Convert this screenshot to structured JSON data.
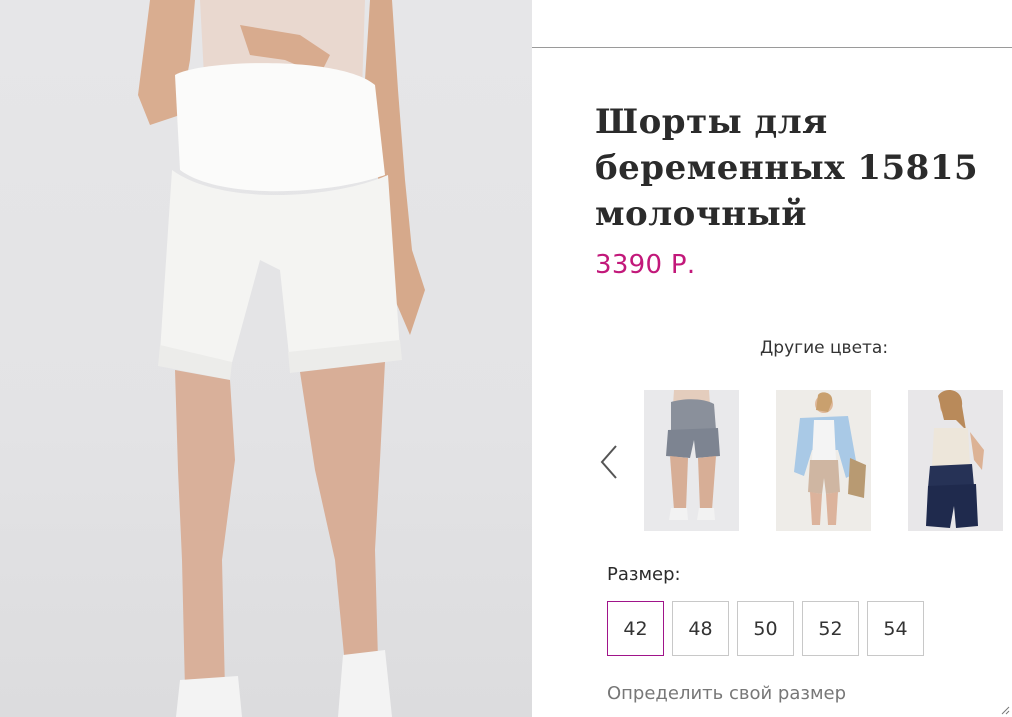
{
  "product": {
    "title": "Шорты для беременных 15815 молочный",
    "price": "3390 Р."
  },
  "colors": {
    "label": "Другие цвета:",
    "swatches": [
      {
        "name": "grey-shorts-swatch",
        "color": "#7d8491"
      },
      {
        "name": "beige-shorts-swatch",
        "color": "#cfb6a2"
      },
      {
        "name": "navy-shorts-swatch",
        "color": "#1f2a4d"
      }
    ]
  },
  "sizes": {
    "label": "Размер:",
    "options": [
      "42",
      "48",
      "50",
      "52",
      "54"
    ],
    "selected": "42"
  },
  "links": {
    "define_size": "Определить свой размер"
  },
  "theme": {
    "price_color": "#c2187a",
    "selected_border": "#a0148a"
  }
}
